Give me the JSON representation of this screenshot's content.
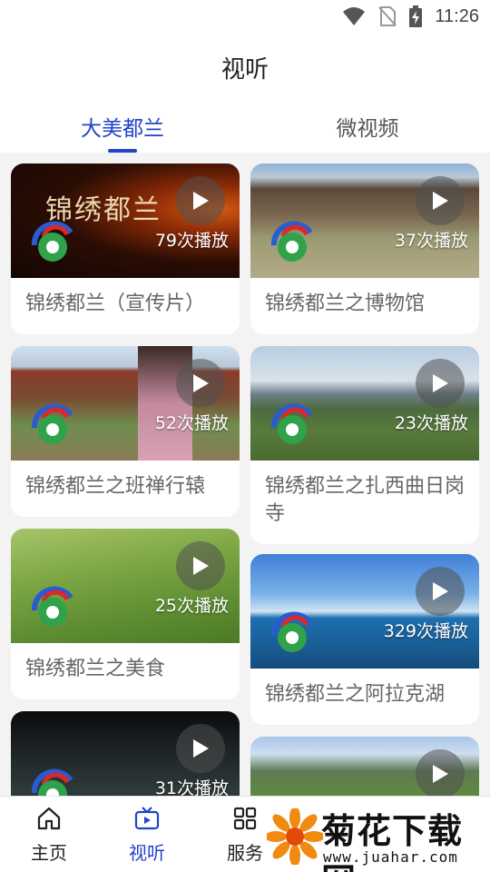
{
  "status_bar": {
    "time": "11:26",
    "icons": [
      "wifi-icon",
      "no-sim-icon",
      "battery-charging-icon"
    ]
  },
  "header": {
    "title": "视听"
  },
  "tabs": [
    {
      "label": "大美都兰",
      "active": true
    },
    {
      "label": "微视频",
      "active": false
    }
  ],
  "videos_left": [
    {
      "title": "锦绣都兰（宣传片）",
      "views": "79次播放",
      "overlay_text": "锦绣都兰"
    },
    {
      "title": "锦绣都兰之班禅行辕",
      "views": "52次播放"
    },
    {
      "title": "锦绣都兰之美食",
      "views": "25次播放"
    },
    {
      "title": "",
      "views": "31次播放"
    }
  ],
  "videos_right": [
    {
      "title": "锦绣都兰之博物馆",
      "views": "37次播放"
    },
    {
      "title": "锦绣都兰之扎西曲日岗寺",
      "views": "23次播放"
    },
    {
      "title": "锦绣都兰之阿拉克湖",
      "views": "329次播放"
    },
    {
      "title": "",
      "views": ""
    }
  ],
  "bottom_nav": [
    {
      "label": "主页",
      "icon": "home-icon",
      "active": false
    },
    {
      "label": "视听",
      "icon": "tv-icon",
      "active": true
    },
    {
      "label": "服务",
      "icon": "grid-icon",
      "active": false
    }
  ],
  "watermark": {
    "name": "菊花下载网",
    "url": "www.juahar.com"
  },
  "colors": {
    "accent": "#2143c8",
    "background": "#f3f3f3"
  }
}
